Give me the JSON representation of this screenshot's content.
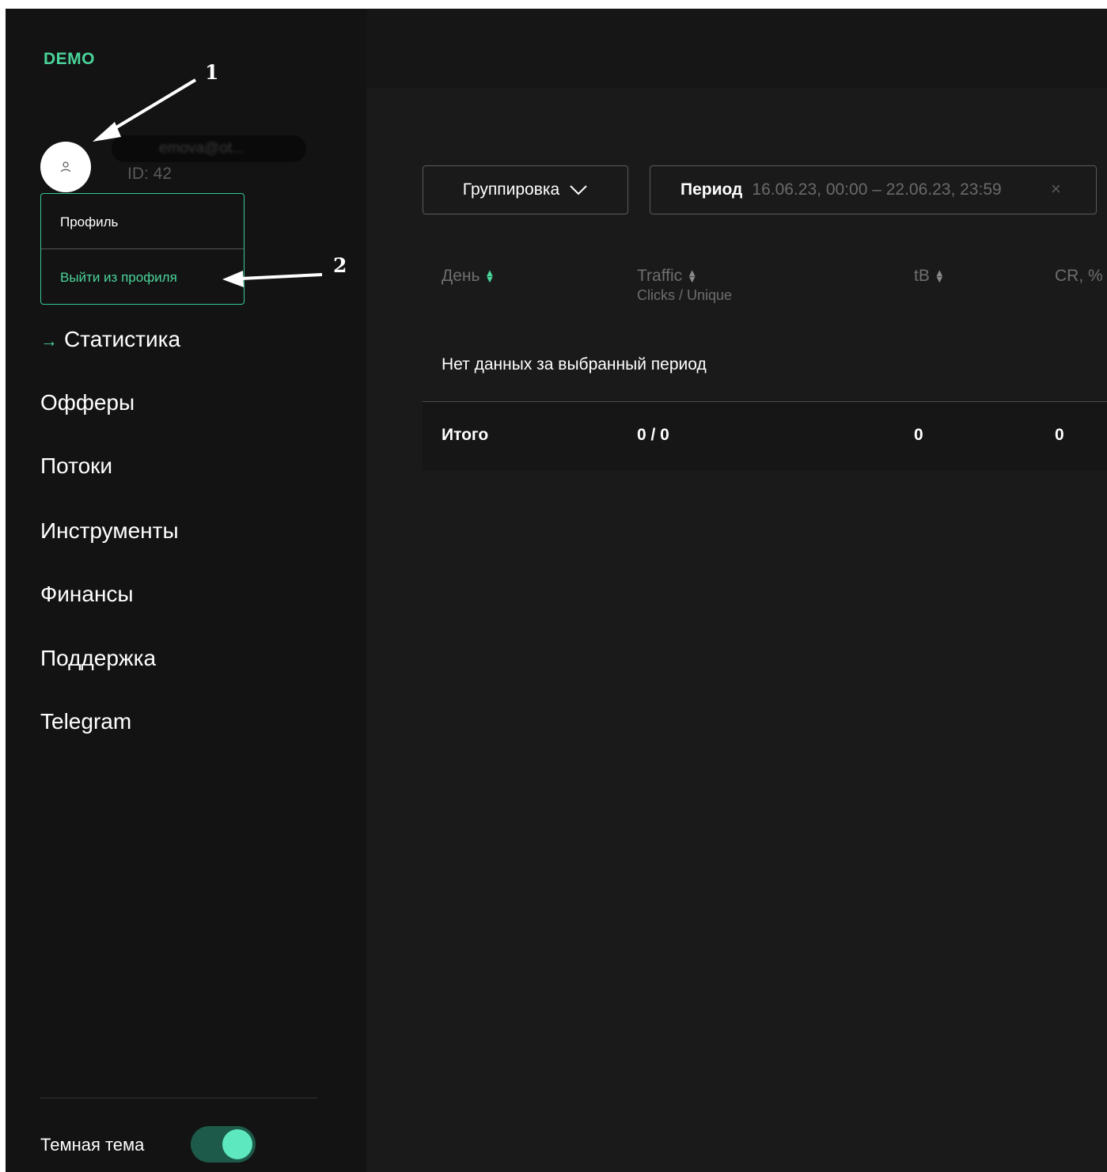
{
  "sidebar": {
    "logo": "DEMO",
    "user": {
      "email_masked": "emova@ot...",
      "id_label": "ID: 42",
      "avatar_icon": "user-icon"
    },
    "profile_menu": {
      "profile_label": "Профиль",
      "logout_label": "Выйти из профиля"
    },
    "nav": {
      "active_arrow": "→",
      "items": [
        "Статистика",
        "Офферы",
        "Потоки",
        "Инструменты",
        "Финансы",
        "Поддержка",
        "Telegram"
      ]
    },
    "theme": {
      "label": "Темная тема",
      "dark_enabled": true
    }
  },
  "annotations": [
    "1",
    "2"
  ],
  "filters": {
    "grouping_label": "Группировка",
    "period_label": "Период",
    "period_value": "16.06.23, 00:00 – 22.06.23, 23:59",
    "clear_symbol": "×"
  },
  "table": {
    "headers": [
      {
        "label": "День",
        "sub": ""
      },
      {
        "label": "Traffic",
        "sub": "Clicks / Unique"
      },
      {
        "label": "tB",
        "sub": ""
      },
      {
        "label": "CR, %",
        "sub": ""
      }
    ],
    "empty_message": "Нет данных за выбранный период",
    "totals": [
      "Итого",
      "0 / 0",
      "0",
      "0"
    ]
  },
  "colors": {
    "accent": "#4ad49a",
    "background": "#1a1a1a",
    "sidebar": "#131313",
    "toggle_knob": "#5de8c0"
  }
}
